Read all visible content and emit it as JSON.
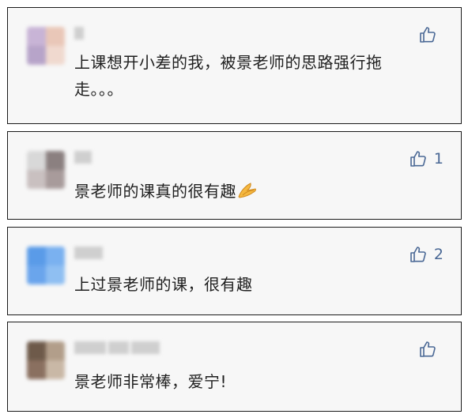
{
  "comments": [
    {
      "text_line1": "上课想开小差的我，被景老师的思路强行拖",
      "text_line2": "走。。。",
      "like_count": "",
      "avatar_colors": [
        "#c8b4d6",
        "#e9c7b8",
        "#b7a4c9",
        "#f0d9cf"
      ]
    },
    {
      "text_line1": "景老师的课真的很有趣",
      "like_count": "1",
      "emoji": "clapping-hands-emoji",
      "avatar_colors": [
        "#d8d8d8",
        "#8b8080",
        "#c9c0c0",
        "#a89b9b"
      ]
    },
    {
      "text_line1": "上过景老师的课，很有趣",
      "like_count": "2",
      "avatar_colors": [
        "#5a9be8",
        "#7ab1f0",
        "#6aa5ec",
        "#8fbff2"
      ]
    },
    {
      "text_line1": "景老师非常棒，爱宁!",
      "like_count": "",
      "avatar_colors": [
        "#6e5a4a",
        "#b29e8a",
        "#8a7060",
        "#c9b8a6"
      ]
    }
  ],
  "colors": {
    "accent": "#4a6895",
    "card_bg": "#f7f7f7",
    "border": "#1a1a1a"
  },
  "icons": {
    "like": "thumbs-up-icon"
  }
}
